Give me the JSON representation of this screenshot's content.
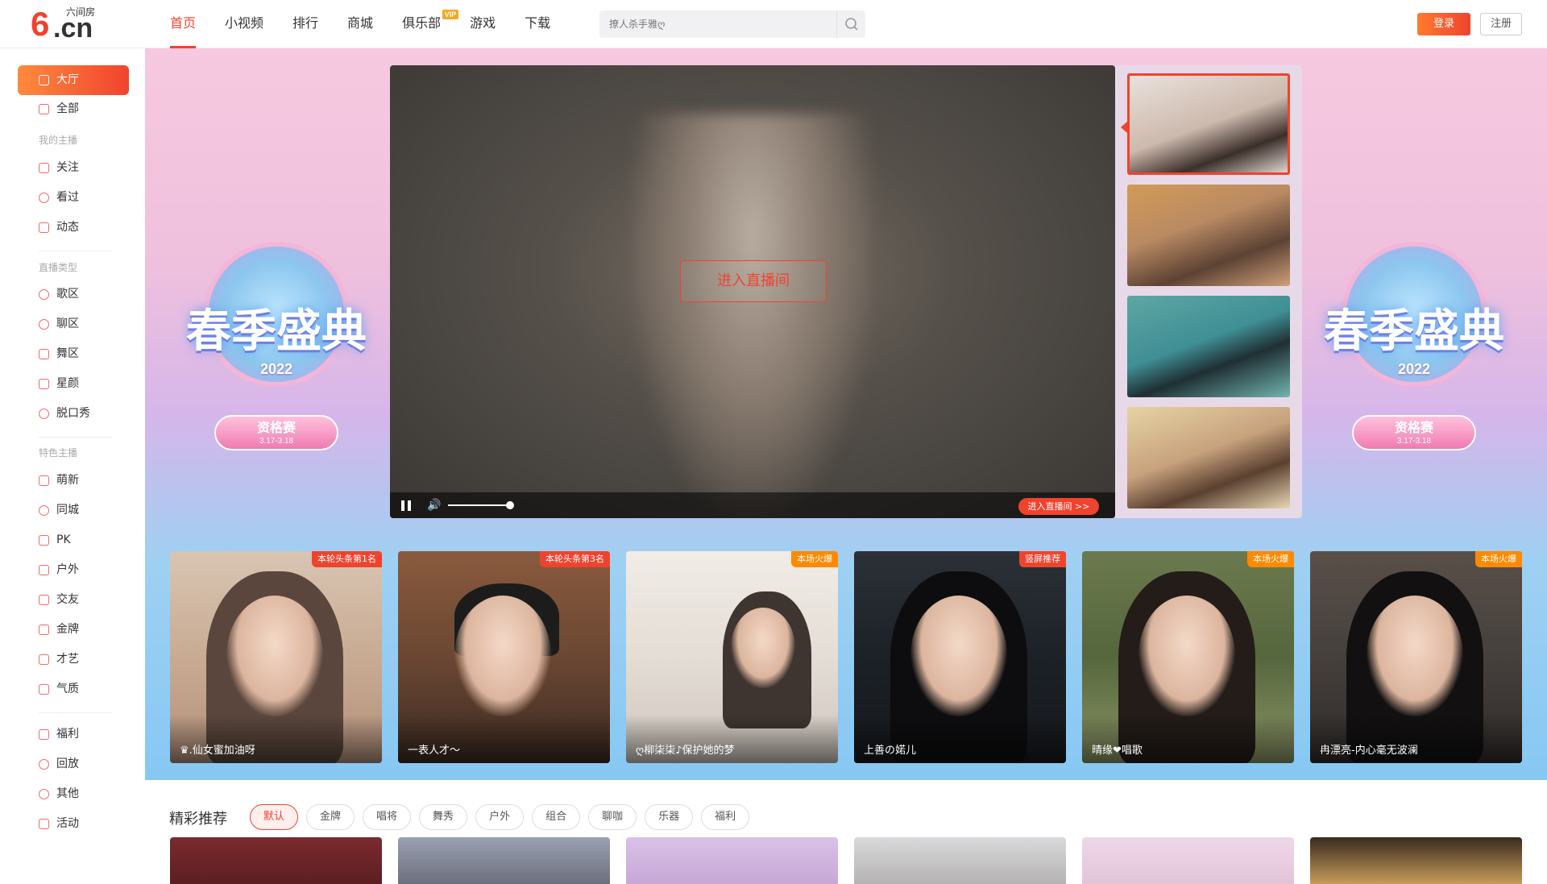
{
  "header": {
    "logo_six": "6",
    "logo_cn": ".cn",
    "logo_sub": "六间房",
    "nav": [
      {
        "label": "首页",
        "active": true
      },
      {
        "label": "小视频"
      },
      {
        "label": "排行"
      },
      {
        "label": "商城"
      },
      {
        "label": "俱乐部",
        "badge": "VIP"
      },
      {
        "label": "游戏"
      },
      {
        "label": "下载"
      }
    ],
    "search_placeholder": "撩人杀手雅ღ",
    "login": "登录",
    "register": "注册"
  },
  "sidebar": {
    "items": [
      {
        "label": "大厅",
        "icon": "home-icon",
        "active": true
      },
      {
        "label": "全部",
        "icon": "grid-icon"
      },
      {
        "label": "关注",
        "icon": "heart-icon"
      },
      {
        "label": "看过",
        "icon": "clock-icon"
      },
      {
        "label": "动态",
        "icon": "message-icon"
      },
      {
        "label": "歌区",
        "icon": "music-icon"
      },
      {
        "label": "聊区",
        "icon": "chat-icon"
      },
      {
        "label": "舞区",
        "icon": "dance-icon"
      },
      {
        "label": "星颜",
        "icon": "mask-icon"
      },
      {
        "label": "脱口秀",
        "icon": "mic-icon"
      },
      {
        "label": "萌新",
        "icon": "sprout-icon"
      },
      {
        "label": "同城",
        "icon": "location-icon"
      },
      {
        "label": "PK",
        "icon": "lightning-icon"
      },
      {
        "label": "户外",
        "icon": "tent-icon"
      },
      {
        "label": "交友",
        "icon": "users-icon"
      },
      {
        "label": "金牌",
        "icon": "medal-icon"
      },
      {
        "label": "才艺",
        "icon": "tag-icon"
      },
      {
        "label": "气质",
        "icon": "crown-icon"
      },
      {
        "label": "福利",
        "icon": "gift-icon"
      },
      {
        "label": "回放",
        "icon": "replay-icon"
      },
      {
        "label": "其他",
        "icon": "more-icon"
      },
      {
        "label": "活动",
        "icon": "star-icon"
      }
    ],
    "categories": [
      "我的主播",
      "直播类型",
      "特色主播"
    ]
  },
  "banner": {
    "left_title": "春季盛典",
    "left_year": "2022",
    "left_pill": "资格赛",
    "left_date": "3.17-3.18",
    "right_title": "春季盛典",
    "right_year": "2022",
    "right_pill": "资格赛",
    "right_date": "3.17-3.18"
  },
  "player": {
    "enter_room": "进入直播间",
    "enter_small": "进入直播间 >>",
    "volume": 0.8
  },
  "cards": [
    {
      "badge": "本轮头条第1名",
      "nick": "♛.仙女蜜加油呀",
      "badge_color": "#f0432e"
    },
    {
      "badge": "本轮头条第3名",
      "nick": "一表人才～",
      "badge_color": "#f0432e"
    },
    {
      "badge": "本场火爆",
      "nick": "ღ柳柒柒♪保护她的梦",
      "badge_color": "#ff8a00"
    },
    {
      "badge": "竖屏推荐",
      "nick": "上善の婼儿",
      "badge_color": "#f0432e"
    },
    {
      "badge": "本场火爆",
      "nick": "晴缘❤唱歌",
      "badge_color": "#ff8a00"
    },
    {
      "badge": "本场火爆",
      "nick": "冉漂亮-内心毫无波澜",
      "badge_color": "#ff8a00"
    }
  ],
  "recommend": {
    "title": "精彩推荐",
    "tags": [
      "默认",
      "金牌",
      "唱将",
      "舞秀",
      "户外",
      "组合",
      "聊咖",
      "乐器",
      "福利"
    ]
  },
  "colors": {
    "accent": "#f0432e",
    "orange": "#ff8a00"
  }
}
